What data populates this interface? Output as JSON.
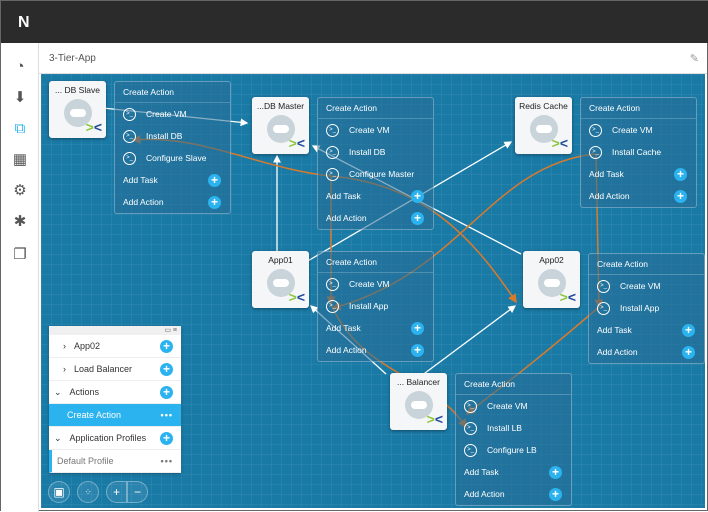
{
  "app": {
    "logo": "N",
    "title": "3-Tier-App"
  },
  "sidebar": [
    {
      "icon": "dashboard-icon",
      "glyph": "◔"
    },
    {
      "icon": "download-icon",
      "glyph": "⬇"
    },
    {
      "icon": "blueprint-icon",
      "glyph": "⧉"
    },
    {
      "icon": "apps-grid-icon",
      "glyph": "▦"
    },
    {
      "icon": "settings-icon",
      "glyph": "⚙"
    },
    {
      "icon": "admin-gear-icon",
      "glyph": "✱"
    },
    {
      "icon": "windows-icon",
      "glyph": "❐"
    }
  ],
  "nodes": [
    {
      "name": "... DB Slave",
      "actions": {
        "title": "Create Action",
        "tasks": [
          "Create VM",
          "Install DB",
          "Configure Slave"
        ]
      }
    },
    {
      "name": "...DB Master",
      "actions": {
        "title": "Create Action",
        "tasks": [
          "Create VM",
          "Install DB",
          "Configure Master"
        ]
      }
    },
    {
      "name": "Redis Cache",
      "actions": {
        "title": "Create Action",
        "tasks": [
          "Create VM",
          "Install Cache"
        ]
      }
    },
    {
      "name": "App01",
      "actions": {
        "title": "Create Action",
        "tasks": [
          "Create VM",
          "Install App"
        ]
      }
    },
    {
      "name": "App02",
      "actions": {
        "title": "Create Action",
        "tasks": [
          "Create VM",
          "Install App"
        ]
      }
    },
    {
      "name": "... Balancer",
      "actions": {
        "title": "Create Action",
        "tasks": [
          "Create VM",
          "Install LB",
          "Configure LB"
        ]
      }
    }
  ],
  "box_labels": {
    "add_task": "Add Task",
    "add_action": "Add Action",
    "task_icon": ">_"
  },
  "panel": {
    "items": [
      {
        "label": "App02",
        "kind": "child",
        "chevron": "›"
      },
      {
        "label": "Load Balancer",
        "kind": "child",
        "chevron": "›"
      },
      {
        "label": "Actions",
        "kind": "section",
        "chevron": "⌄"
      },
      {
        "label": "Create Action",
        "kind": "selected"
      },
      {
        "label": "Application Profiles",
        "kind": "section",
        "chevron": "⌄"
      },
      {
        "label": "Default Profile",
        "kind": "profile"
      }
    ]
  },
  "controls": {
    "zoom_in": "+",
    "zoom_out": "−"
  },
  "colors": {
    "canvas": "#1a7aa6",
    "accent": "#2bb3ef",
    "dependency": "#d97a2b"
  }
}
